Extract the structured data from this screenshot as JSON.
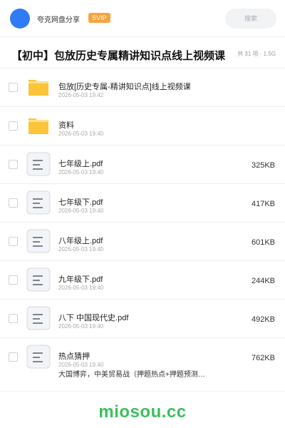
{
  "header": {
    "username": "夸克网盘分享",
    "vip_badge": "SVIP",
    "search_placeholder": "搜索"
  },
  "share": {
    "title": "【初中】包放历史专属精讲知识点线上视频课",
    "summary": "共 31 项 · 1.5G"
  },
  "files": [
    {
      "type": "folder",
      "name": "包放[历史专属-精讲知识点]线上视频课",
      "date": "2026-05-03 19:42",
      "size": ""
    },
    {
      "type": "folder",
      "name": "资料",
      "date": "2026-05-03 19:40",
      "size": ""
    },
    {
      "type": "doc",
      "name": "七年级上.pdf",
      "date": "2026-05-03 19:40",
      "size": "325KB"
    },
    {
      "type": "doc",
      "name": "七年级下.pdf",
      "date": "2026-05-03 19:40",
      "size": "417KB"
    },
    {
      "type": "doc",
      "name": "八年级上.pdf",
      "date": "2026-05-03 19:40",
      "size": "601KB"
    },
    {
      "type": "doc",
      "name": "九年级下.pdf",
      "date": "2026-05-03 19:40",
      "size": "244KB"
    },
    {
      "type": "doc",
      "name": "八下  中国现代史.pdf",
      "date": "2026-05-03 19:40",
      "size": "492KB"
    },
    {
      "type": "doc",
      "name": "热点猜押",
      "date": "2026-05-03 19:40",
      "size": "762KB",
      "desc": "大国博弈，中美贸易战（押题热点+押题预测…"
    }
  ],
  "watermark": "miosou.cc",
  "colors": {
    "avatar": "#2f7bf5",
    "vip": "#f7a43c",
    "folder": "#fcc43a",
    "watermark": "#3bbf5c"
  }
}
